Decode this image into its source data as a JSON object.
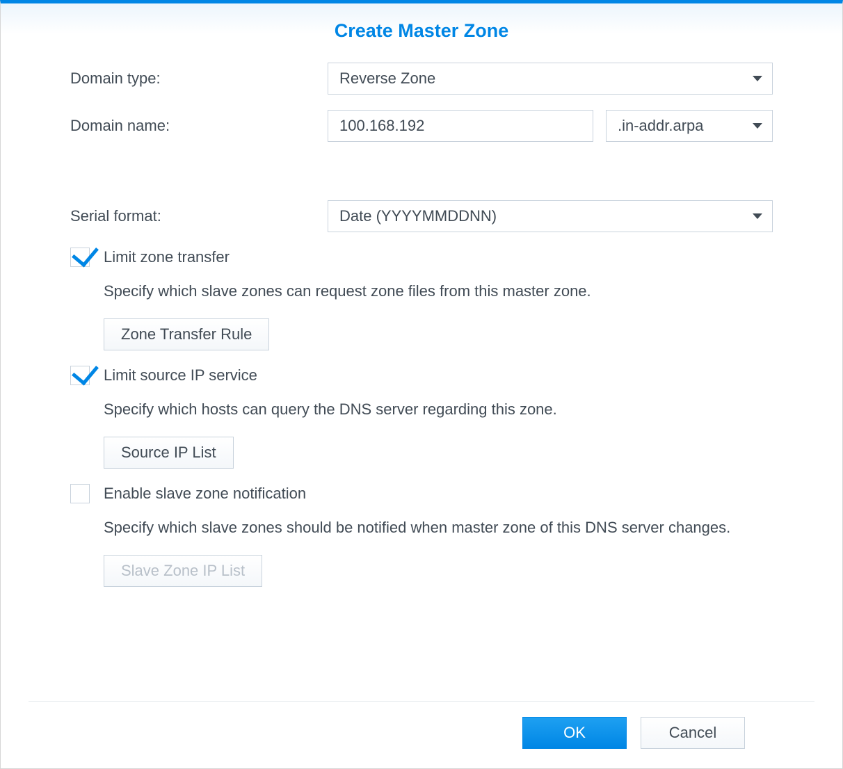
{
  "dialog": {
    "title": "Create Master Zone"
  },
  "form": {
    "domain_type": {
      "label": "Domain type:",
      "value": "Reverse Zone"
    },
    "domain_name": {
      "label": "Domain name:",
      "value": "100.168.192",
      "suffix": ".in-addr.arpa"
    },
    "serial_format": {
      "label": "Serial format:",
      "value": "Date (YYYYMMDDNN)"
    },
    "limit_zone_transfer": {
      "checked": true,
      "label": "Limit zone transfer",
      "description": "Specify which slave zones can request zone files from this master zone.",
      "button": "Zone Transfer Rule"
    },
    "limit_source_ip": {
      "checked": true,
      "label": "Limit source IP service",
      "description": "Specify which hosts can query the DNS server regarding this zone.",
      "button": "Source IP List"
    },
    "enable_slave_notification": {
      "checked": false,
      "label": "Enable slave zone notification",
      "description": "Specify which slave zones should be notified when master zone of this DNS server changes.",
      "button": "Slave Zone IP List"
    }
  },
  "footer": {
    "ok": "OK",
    "cancel": "Cancel"
  }
}
